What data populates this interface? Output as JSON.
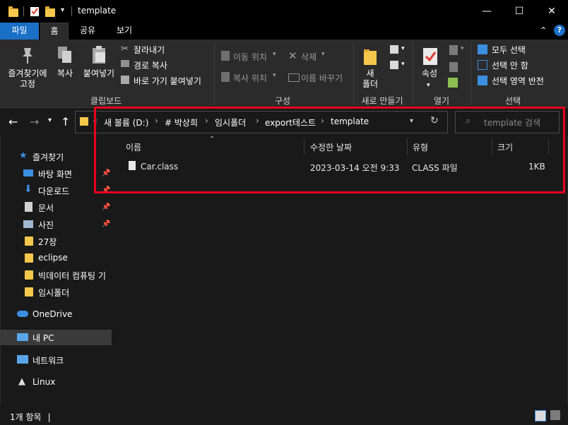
{
  "window": {
    "title": "template",
    "minimize_glyph": "—",
    "maximize_glyph": "☐",
    "close_glyph": "✕"
  },
  "ribbon_tabs": [
    "파일",
    "홈",
    "공유",
    "보기"
  ],
  "ribbon": {
    "clipboard": {
      "pin_label_1": "즐겨찾기에",
      "pin_label_2": "고정",
      "copy_label": "복사",
      "paste_label": "붙여넣기",
      "cut_label": "잘라내기",
      "copy_path_label": "경로 복사",
      "paste_shortcut_label": "바로 가기 붙여넣기",
      "group_label": "클립보드"
    },
    "organize": {
      "move_to_label": "이동 위치",
      "copy_to_label": "복사 위치",
      "delete_label": "삭제",
      "rename_label": "이름 바꾸기",
      "group_label": "구성"
    },
    "new": {
      "new_folder_label_1": "새",
      "new_folder_label_2": "폴더",
      "group_label": "새로 만들기"
    },
    "open": {
      "properties_label": "속성",
      "group_label": "열기"
    },
    "select": {
      "select_all_label": "모두 선택",
      "select_none_label": "선택 안 함",
      "invert_selection_label": "선택 영역 반전",
      "group_label": "선택"
    }
  },
  "address": {
    "overflow": "«",
    "breadcrumbs": [
      "새 볼륨 (D:)",
      "# 박상희",
      "임시폴더",
      "export테스트",
      "template"
    ],
    "search_placeholder": "template 검색"
  },
  "nav_pane": {
    "quick_access": "즐겨찾기",
    "items": [
      {
        "label": "바탕 화면",
        "icon": "desktop-icon",
        "pinned": true
      },
      {
        "label": "다운로드",
        "icon": "download-icon",
        "pinned": true
      },
      {
        "label": "문서",
        "icon": "document-icon",
        "pinned": true
      },
      {
        "label": "사진",
        "icon": "pictures-icon",
        "pinned": true
      },
      {
        "label": "27장",
        "icon": "folder-icon",
        "pinned": false
      },
      {
        "label": "eclipse",
        "icon": "folder-icon",
        "pinned": false
      },
      {
        "label": "빅데이터 컴퓨팅 기",
        "icon": "folder-icon",
        "pinned": false
      },
      {
        "label": "임시폴더",
        "icon": "folder-icon",
        "pinned": false
      }
    ],
    "onedrive": "OneDrive",
    "this_pc": "내 PC",
    "network": "네트워크",
    "linux": "Linux"
  },
  "file_list": {
    "columns": [
      "이름",
      "수정한 날짜",
      "유형",
      "크기"
    ],
    "rows": [
      {
        "name": "Car.class",
        "modified": "2023-03-14 오전 9:33",
        "type": "CLASS 파일",
        "size": "1KB"
      }
    ]
  },
  "status_bar": {
    "item_count": "1개 항목"
  },
  "colors": {
    "file_tab": "#1a6fc6",
    "highlight_box": "#e8001c",
    "folder": "#f5c84c"
  }
}
